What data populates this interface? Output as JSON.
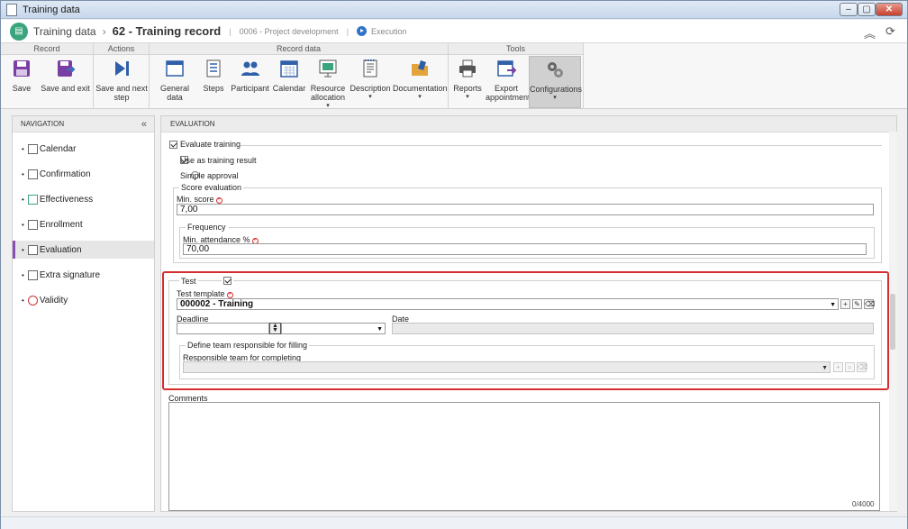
{
  "window": {
    "title": "Training data"
  },
  "header": {
    "app": "Training data",
    "record": "62 - Training record",
    "project": "0006 - Project development",
    "status": "Execution"
  },
  "ribbon": {
    "groups": {
      "record": "Record",
      "actions": "Actions",
      "record_data": "Record data",
      "tools": "Tools"
    },
    "buttons": {
      "save": "Save",
      "save_exit": "Save and exit",
      "save_next_1": "Save and next",
      "save_next_2": "step",
      "general": "General data",
      "steps": "Steps",
      "participant": "Participant",
      "calendar": "Calendar",
      "resource_1": "Resource",
      "resource_2": "allocation",
      "description": "Description",
      "documentation": "Documentation",
      "reports": "Reports",
      "export_1": "Export",
      "export_2": "appointment",
      "configurations": "Configurations"
    },
    "dropdown_glyph": "▾"
  },
  "nav": {
    "title": "NAVIGATION",
    "collapse": "«",
    "items": [
      "Calendar",
      "Confirmation",
      "Effectiveness",
      "Enrollment",
      "Evaluation",
      "Extra signature",
      "Validity"
    ],
    "bullet": "•"
  },
  "main": {
    "title": "EVALUATION",
    "evaluate_training": "Evaluate training",
    "use_as_result": "Use as training result",
    "simple_approval": "Simple approval",
    "score_evaluation": "Score evaluation",
    "min_score_label": "Min. score",
    "min_score_value": "7,00",
    "frequency": "Frequency",
    "min_attendance_label": "Min. attendance %",
    "min_attendance_value": "70,00",
    "test": "Test",
    "test_template_label": "Test template",
    "test_template_value": "000002 - Training",
    "deadline_label": "Deadline",
    "date_label": "Date",
    "define_team": "Define team responsible for filling",
    "responsible_team_label": "Responsible team for completing",
    "comments_label": "Comments",
    "char_count": "0/4000"
  },
  "colors": {
    "highlight": "#d62d2d",
    "nav_selected": "#8a4fb3",
    "accent": "#2e74c9",
    "logo": "#3aa57c"
  }
}
